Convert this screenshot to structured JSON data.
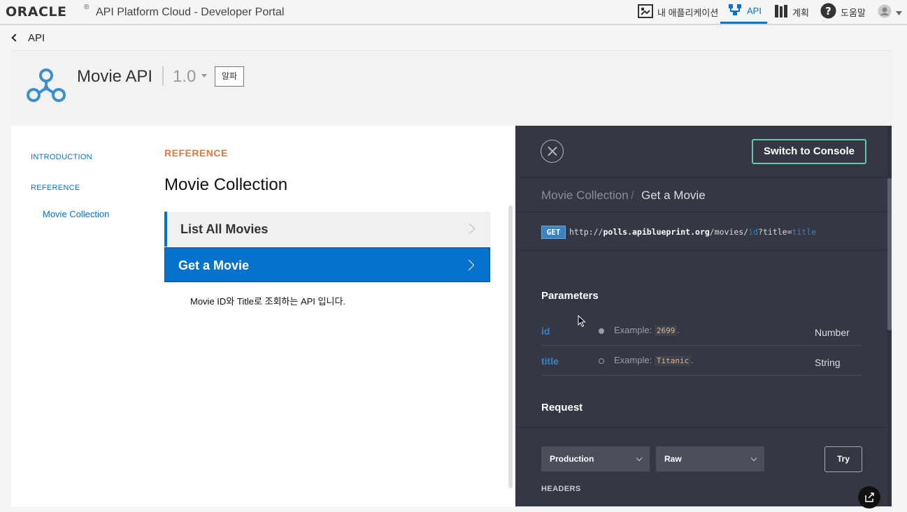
{
  "topbar": {
    "logo": "ORACLE",
    "registered": "®",
    "portal_title": "API Platform Cloud  -  Developer Portal",
    "nav": [
      {
        "label": "내 애플리케이션",
        "icon": "app-icon"
      },
      {
        "label": "API",
        "icon": "api-icon"
      },
      {
        "label": "계획",
        "icon": "plan-icon"
      },
      {
        "label": "도움말",
        "icon": "help-icon"
      }
    ],
    "user_icon": "user-avatar-icon"
  },
  "back": {
    "label": "API"
  },
  "api": {
    "name": "Movie API",
    "version": "1.0",
    "badge": "알파"
  },
  "sidenav": {
    "items": [
      {
        "label": "INTRODUCTION"
      },
      {
        "label": "REFERENCE"
      },
      {
        "label": "Movie Collection"
      }
    ]
  },
  "reference": {
    "label": "REFERENCE",
    "collection_title": "Movie Collection",
    "operations": [
      {
        "label": "List All Movies"
      },
      {
        "label": "Get a Movie"
      }
    ],
    "description": "Movie ID와 Title로 조회하는 API 입니다."
  },
  "console": {
    "switch_label": "Switch to Console",
    "breadcrumb": {
      "collection": "Movie Collection",
      "separator": "/",
      "operation": "Get a Movie"
    },
    "method": "GET",
    "url": {
      "prefix": "http://",
      "host": "polls.apiblueprint.org",
      "path": "/movies/",
      "param1": "id",
      "query": "?title=",
      "param2": "title"
    },
    "parameters_title": "Parameters",
    "parameters": [
      {
        "name": "id",
        "example_label": "Example:",
        "example": "2699",
        "suffix": ".",
        "type": "Number",
        "required": true
      },
      {
        "name": "title",
        "example_label": "Example:",
        "example": "Titanic",
        "suffix": ".",
        "type": "String",
        "required": false
      }
    ],
    "request_title": "Request",
    "environment": "Production",
    "format": "Raw",
    "try_label": "Try",
    "headers_label": "HEADERS"
  },
  "colors": {
    "accent": "#0572ce",
    "reference_orange": "#e07b39",
    "console_bg": "#343844",
    "console_button_border": "#6cc7a7"
  }
}
